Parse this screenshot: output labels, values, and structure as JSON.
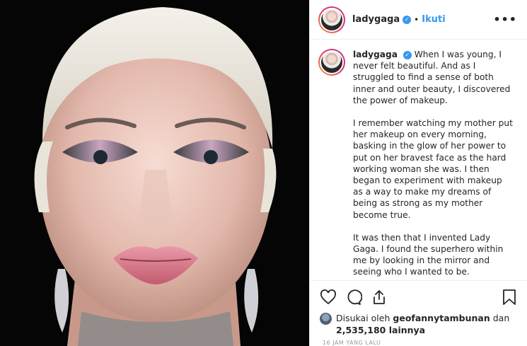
{
  "post": {
    "username": "ladygaga",
    "follow_label": "Ikuti",
    "bullet": "•",
    "more_label": "•••",
    "caption": {
      "username": "ladygaga",
      "paragraphs": [
        "When I was young, I never felt beautiful. And as I struggled to find a sense of both inner and outer beauty, I discovered the power of makeup.",
        "I remember watching my mother put her makeup on every morning, basking in the glow of her power to put on her bravest face as the hard working woman she was. I then began to experiment with makeup as a way to make my dreams of being as strong as my mother become true.",
        "It was then that I invented Lady Gaga. I found the superhero within me by looking in the mirror and seeing who I wanted to be."
      ]
    },
    "likes": {
      "prefix": "Disukai oleh",
      "liker": "geofannytambunan",
      "conj": "dan",
      "count": "2,535,180 lainnya"
    },
    "timestamp": "16 JAM YANG LALU"
  },
  "icons": {
    "like": "heart-icon",
    "comment": "comment-icon",
    "share": "share-icon",
    "save": "bookmark-icon",
    "verified": "verified-badge-icon"
  },
  "colors": {
    "accent_blue": "#3897f0",
    "text": "#262626",
    "border": "#efefef"
  }
}
